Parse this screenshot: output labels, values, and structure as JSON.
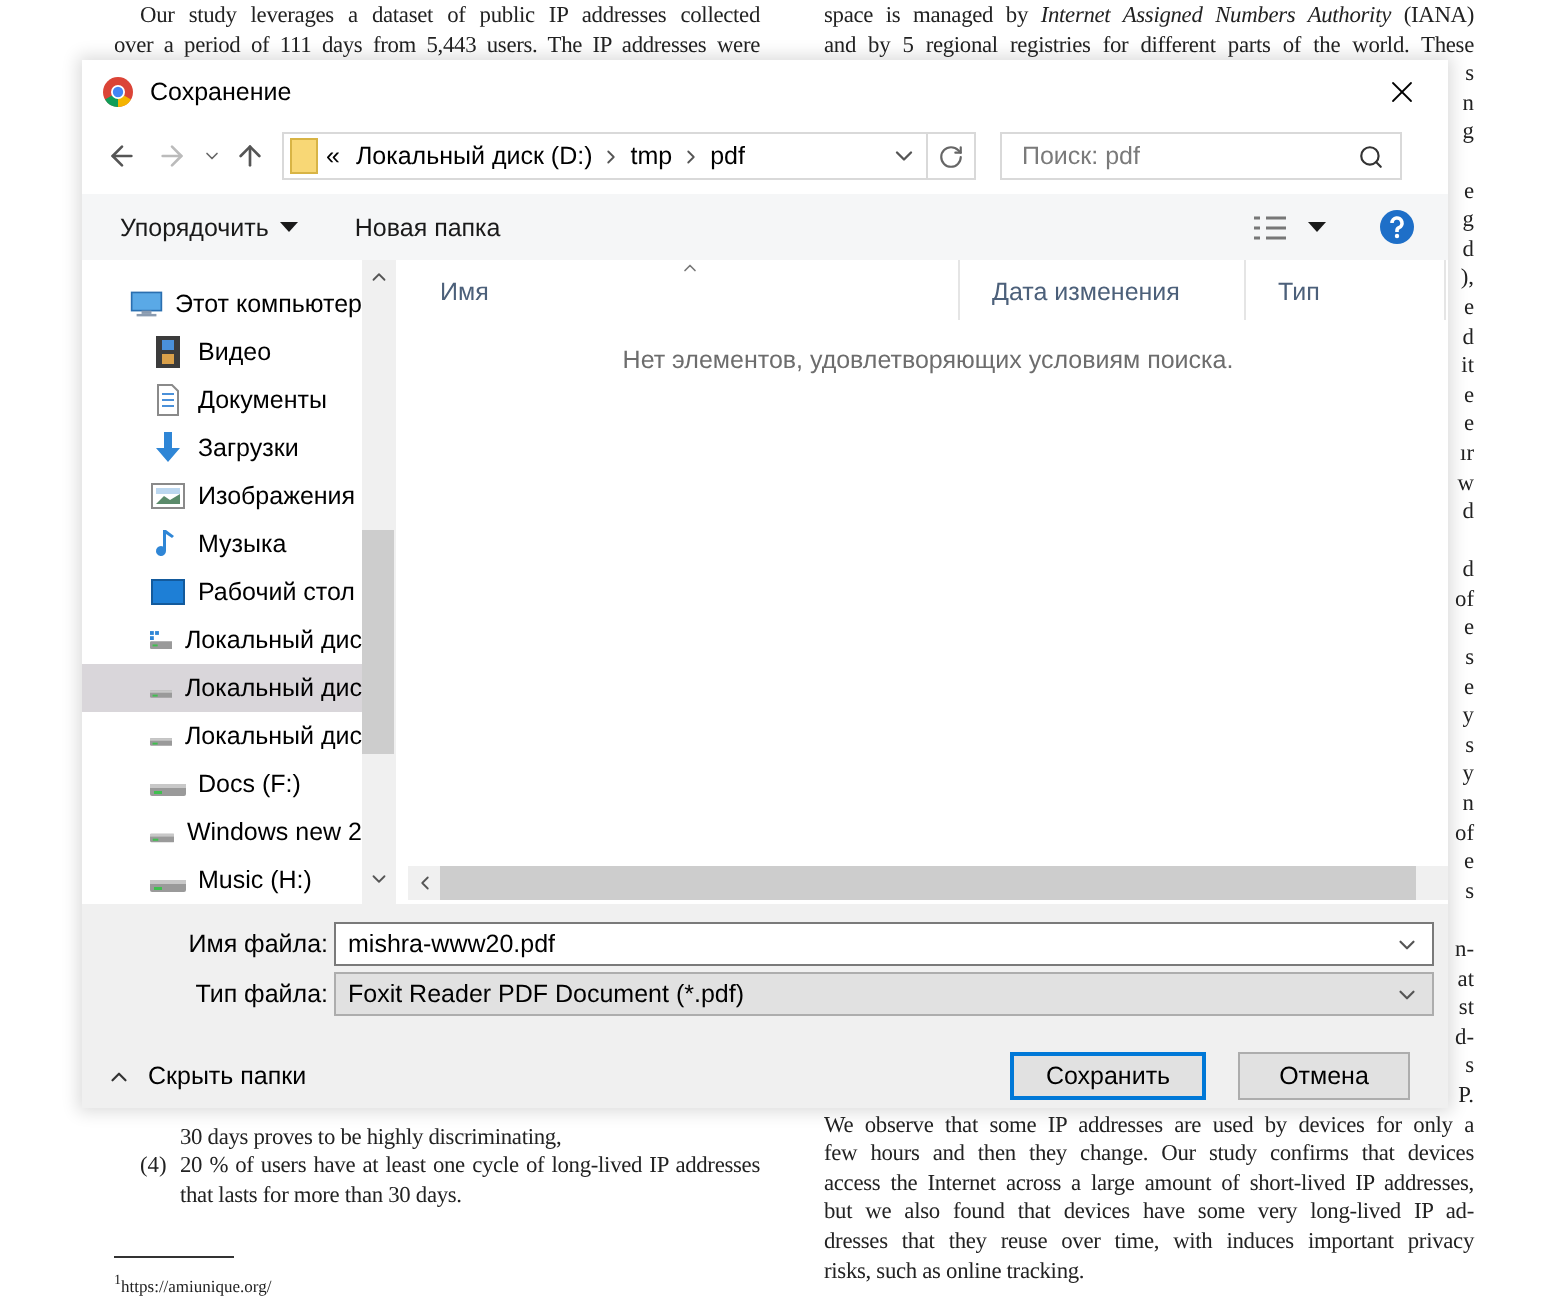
{
  "document": {
    "left_column": {
      "top_lines": [
        "Our study leverages a dataset of public IP addresses collected",
        "over a period of 111 days from 5,443 users. The IP addresses were"
      ],
      "bottom_lines": [
        {
          "kind": "continuation",
          "text": "30 days proves to be highly discriminating,"
        },
        {
          "kind": "list_item",
          "marker": "(4)",
          "text": "20 % of users have at least one cycle of long-lived IP addresses"
        },
        {
          "kind": "continuation",
          "text": "that lasts for more than 30 days."
        }
      ],
      "footnote": "$^{1}$https://amiunique.org/"
    },
    "right_column": {
      "top_lines": [
        "space is managed by *Internet Assigned Numbers Authority* (IANA)",
        "and by 5 regional registries for different parts of the world. These"
      ],
      "edge_fragment_paragraphs": [
        [
          "s",
          "n",
          "g"
        ],
        [
          "e",
          "g",
          "d",
          "),",
          "e",
          "d",
          "it",
          "e",
          "e",
          "ır",
          "w",
          "d"
        ],
        [
          "d",
          "of",
          "e",
          "s",
          "e",
          "y",
          "s",
          "y",
          "n",
          "of",
          "e",
          "s"
        ],
        [
          "n-",
          "at",
          "st",
          "d-",
          "s",
          "P."
        ]
      ],
      "bottom_lines": [
        "We observe that some IP addresses are used by devices for only a",
        "few hours and then they change. Our study confirms that devices",
        "access the Internet across a large amount of short-lived IP addresses,",
        "but we also found that devices have some very long-lived IP ad-",
        "dresses that they reuse over time, with induces important privacy",
        "risks, such as online tracking."
      ]
    }
  },
  "dialog": {
    "title": "Сохранение",
    "address": {
      "overflow_mark": "«",
      "segments": [
        "Локальный диск (D:)",
        "tmp",
        "pdf"
      ]
    },
    "search": {
      "placeholder": "Поиск: pdf"
    },
    "toolbar": {
      "organize": "Упорядочить",
      "new_folder": "Новая папка"
    },
    "nav": [
      {
        "label": "Этот компьютер",
        "kind": "computer",
        "selected": false,
        "children": [
          {
            "label": "Видео",
            "kind": "videos",
            "selected": false
          },
          {
            "label": "Документы",
            "kind": "documents",
            "selected": false
          },
          {
            "label": "Загрузки",
            "kind": "downloads",
            "selected": false
          },
          {
            "label": "Изображения",
            "kind": "pictures",
            "selected": false
          },
          {
            "label": "Музыка",
            "kind": "music",
            "selected": false
          },
          {
            "label": "Рабочий стол",
            "kind": "desktop",
            "selected": false
          },
          {
            "label": "Локальный дис",
            "kind": "system_drive",
            "selected": false
          },
          {
            "label": "Локальный дис",
            "kind": "drive",
            "selected": true
          },
          {
            "label": "Локальный дис",
            "kind": "drive",
            "selected": false
          },
          {
            "label": "Docs (F:)",
            "kind": "drive",
            "selected": false
          },
          {
            "label": "Windows new 2",
            "kind": "drive",
            "selected": false
          },
          {
            "label": "Music (H:)",
            "kind": "drive",
            "selected": false
          }
        ]
      }
    ],
    "columns": [
      "Имя",
      "Дата изменения",
      "Тип"
    ],
    "empty_message": "Нет элементов, удовлетворяющих условиям поиска.",
    "file_name": {
      "label": "Имя файла:",
      "value": "mishra-www20.pdf"
    },
    "file_type": {
      "label": "Тип файла:",
      "value": "Foxit Reader PDF Document (*.pdf)"
    },
    "hide_folders": "Скрыть папки",
    "buttons": [
      {
        "label": "Сохранить",
        "default": true
      },
      {
        "label": "Отмена",
        "default": false
      }
    ]
  }
}
